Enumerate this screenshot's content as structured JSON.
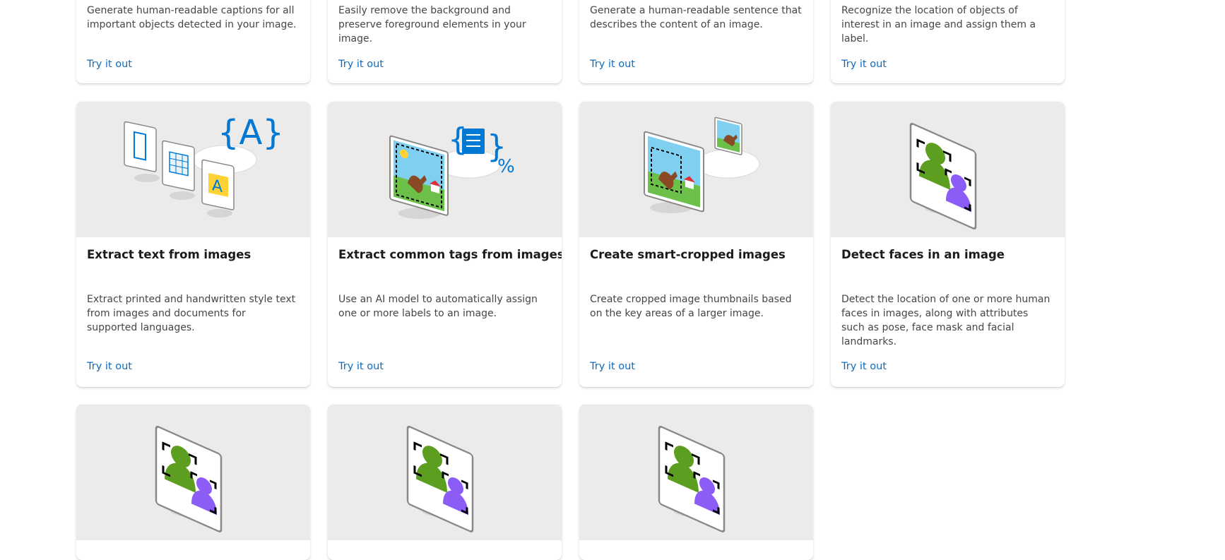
{
  "try_label": "Try it out",
  "row1": [
    {
      "desc": "Generate human-readable captions for all important objects detected in your image."
    },
    {
      "desc": "Easily remove the background and preserve foreground elements in your image."
    },
    {
      "desc": "Generate a human-readable sentence that describes the content of an image."
    },
    {
      "desc": "Recognize the location of objects of interest in an image and assign them a label."
    }
  ],
  "row2": [
    {
      "title": "Extract text from images",
      "desc": "Extract printed and handwritten style text from images and documents for supported languages.",
      "illustration": "ocr-illustration"
    },
    {
      "title": "Extract common tags from images",
      "desc": "Use an AI model to automatically assign one or more labels to an image.",
      "illustration": "tagging-illustration"
    },
    {
      "title": "Create smart-cropped images",
      "desc": "Create cropped image thumbnails based on the key areas of a larger image.",
      "illustration": "smart-crop-illustration"
    },
    {
      "title": "Detect faces in an image",
      "desc": "Detect the location of one or more human faces in images, along with attributes such as pose, face mask and facial landmarks.",
      "illustration": "face-detection-illustration"
    }
  ],
  "row3": [
    {
      "illustration": "face-detection-illustration"
    },
    {
      "illustration": "face-detection-illustration"
    },
    {
      "illustration": "face-detection-illustration"
    }
  ],
  "colors": {
    "link": "#0f6cbd",
    "illustration_bg": "#edebe9",
    "accent_blue": "#0078d4",
    "face_green": "#5c9e1f",
    "face_purple": "#8b5cf6"
  }
}
